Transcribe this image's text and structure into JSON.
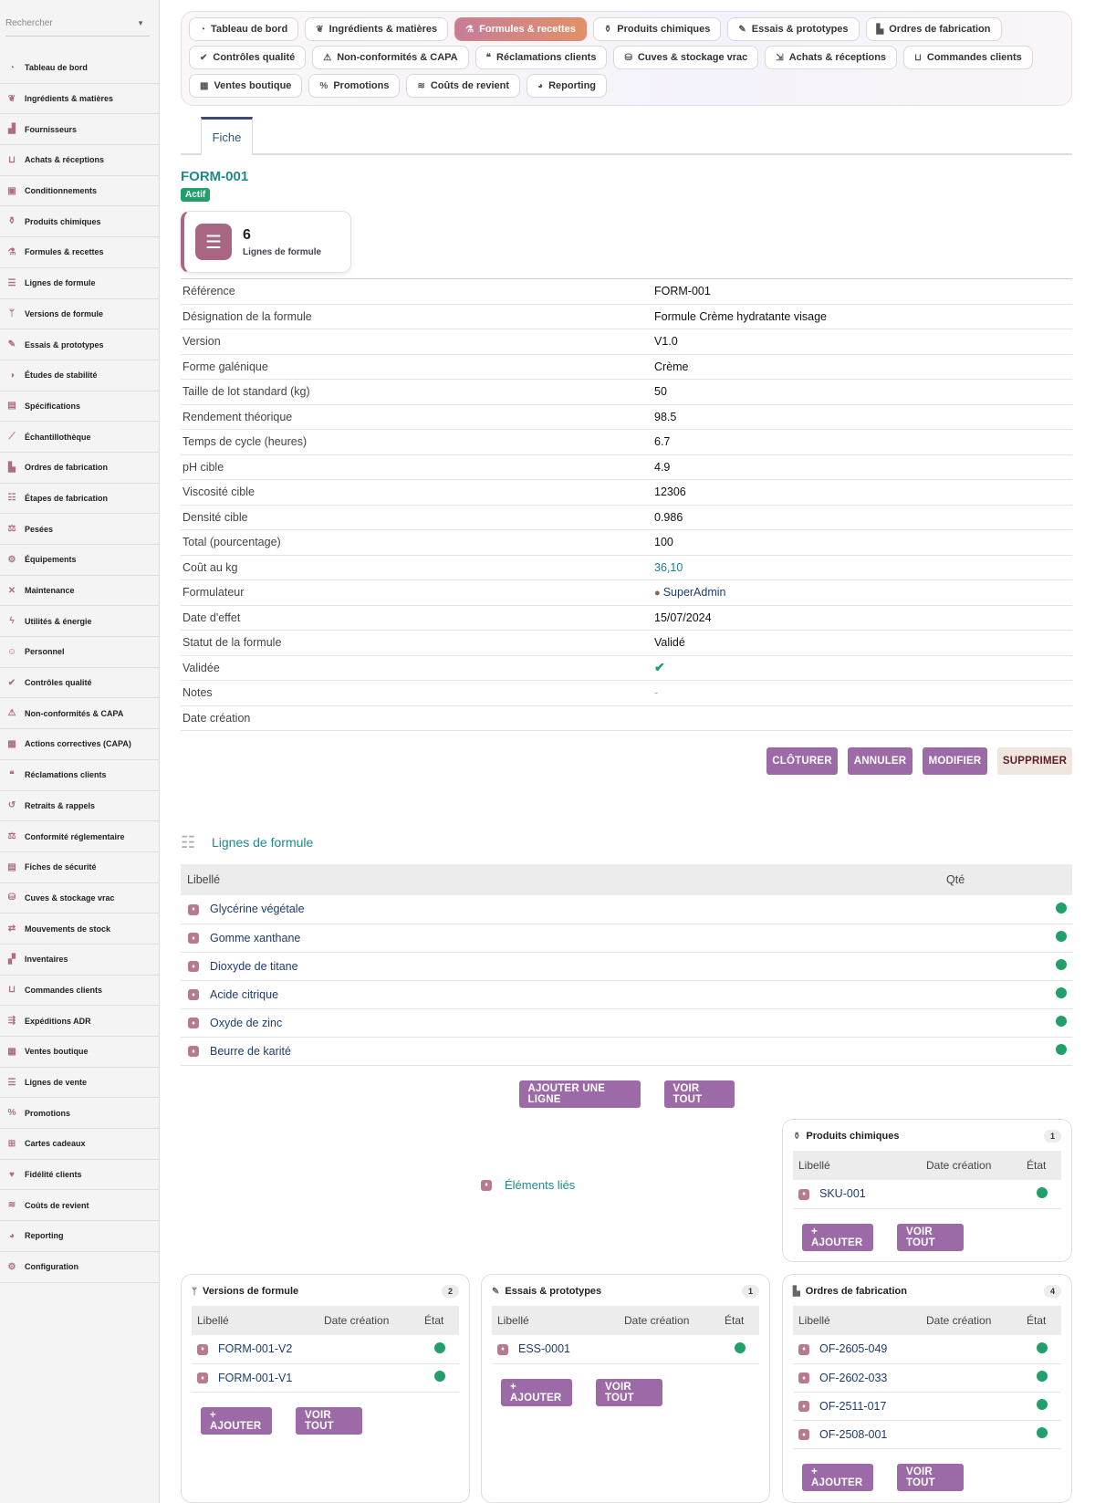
{
  "sidebar": {
    "search_placeholder": "Rechercher",
    "items": [
      {
        "label": "Tableau de bord",
        "icon": "dashboard-icon"
      },
      {
        "label": "Ingrédients & matières",
        "icon": "leaf-icon"
      },
      {
        "label": "Fournisseurs",
        "icon": "truck-icon"
      },
      {
        "label": "Achats & réceptions",
        "icon": "cart-icon"
      },
      {
        "label": "Conditionnements",
        "icon": "box-icon"
      },
      {
        "label": "Produits chimiques",
        "icon": "flask-icon"
      },
      {
        "label": "Formules & recettes",
        "icon": "beaker-icon"
      },
      {
        "label": "Lignes de formule",
        "icon": "list-icon"
      },
      {
        "label": "Versions de formule",
        "icon": "branch-icon"
      },
      {
        "label": "Essais & prototypes",
        "icon": "pen-icon"
      },
      {
        "label": "Études de stabilité",
        "icon": "gauge-icon"
      },
      {
        "label": "Spécifications",
        "icon": "file-icon"
      },
      {
        "label": "Échantillothèque",
        "icon": "pipette-icon"
      },
      {
        "label": "Ordres de fabrication",
        "icon": "factory-icon"
      },
      {
        "label": "Étapes de fabrication",
        "icon": "steps-icon"
      },
      {
        "label": "Pesées",
        "icon": "scale-icon"
      },
      {
        "label": "Équipements",
        "icon": "cogs-icon"
      },
      {
        "label": "Maintenance",
        "icon": "tools-icon"
      },
      {
        "label": "Utilités & énergie",
        "icon": "bolt-icon"
      },
      {
        "label": "Personnel",
        "icon": "users-icon"
      },
      {
        "label": "Contrôles qualité",
        "icon": "check-icon"
      },
      {
        "label": "Non-conformités & CAPA",
        "icon": "warning-icon"
      },
      {
        "label": "Actions correctives (CAPA)",
        "icon": "action-icon"
      },
      {
        "label": "Réclamations clients",
        "icon": "comment-icon"
      },
      {
        "label": "Retraits & rappels",
        "icon": "undo-icon"
      },
      {
        "label": "Conformité réglementaire",
        "icon": "balance-icon"
      },
      {
        "label": "Fiches de sécurité",
        "icon": "doc-icon"
      },
      {
        "label": "Cuves & stockage vrac",
        "icon": "tank-icon"
      },
      {
        "label": "Mouvements de stock",
        "icon": "exchange-icon"
      },
      {
        "label": "Inventaires",
        "icon": "boxes-icon"
      },
      {
        "label": "Commandes clients",
        "icon": "cart-icon"
      },
      {
        "label": "Expéditions ADR",
        "icon": "shipping-icon"
      },
      {
        "label": "Ventes boutique",
        "icon": "register-icon"
      },
      {
        "label": "Lignes de vente",
        "icon": "list-icon"
      },
      {
        "label": "Promotions",
        "icon": "percent-icon"
      },
      {
        "label": "Cartes cadeaux",
        "icon": "gift-icon"
      },
      {
        "label": "Fidélité clients",
        "icon": "heart-icon"
      },
      {
        "label": "Coûts de revient",
        "icon": "coins-icon"
      },
      {
        "label": "Reporting",
        "icon": "chart-icon"
      },
      {
        "label": "Configuration",
        "icon": "gear-icon"
      }
    ]
  },
  "topnav": [
    {
      "label": "Tableau de bord",
      "glyph": "◔",
      "active": false
    },
    {
      "label": "Ingrédients & matières",
      "glyph": "❦",
      "active": false
    },
    {
      "label": "Formules & recettes",
      "glyph": "⚗",
      "active": true
    },
    {
      "label": "Produits chimiques",
      "glyph": "⚱",
      "active": false
    },
    {
      "label": "Essais & prototypes",
      "glyph": "✎",
      "active": false
    },
    {
      "label": "Ordres de fabrication",
      "glyph": "▙",
      "active": false
    },
    {
      "label": "Contrôles qualité",
      "glyph": "✔",
      "active": false
    },
    {
      "label": "Non-conformités & CAPA",
      "glyph": "⚠",
      "active": false
    },
    {
      "label": "Réclamations clients",
      "glyph": "❝",
      "active": false
    },
    {
      "label": "Cuves & stockage vrac",
      "glyph": "⛁",
      "active": false
    },
    {
      "label": "Achats & réceptions",
      "glyph": "⇲",
      "active": false
    },
    {
      "label": "Commandes clients",
      "glyph": "⊔",
      "active": false
    },
    {
      "label": "Ventes boutique",
      "glyph": "▦",
      "active": false
    },
    {
      "label": "Promotions",
      "glyph": "%",
      "active": false
    },
    {
      "label": "Coûts de revient",
      "glyph": "≋",
      "active": false
    },
    {
      "label": "Reporting",
      "glyph": "◕",
      "active": false
    }
  ],
  "tab": {
    "label": "Fiche"
  },
  "record": {
    "title": "FORM-001",
    "status_badge": "Actif",
    "stat": {
      "value": "6",
      "label": "Lignes de formule"
    },
    "fields": [
      {
        "key": "Référence",
        "value": "FORM-001",
        "kind": "text"
      },
      {
        "key": "Désignation de la formule",
        "value": "Formule Crème hydratante visage",
        "kind": "text"
      },
      {
        "key": "Version",
        "value": "V1.0",
        "kind": "text"
      },
      {
        "key": "Forme galénique",
        "value": "Crème",
        "kind": "text"
      },
      {
        "key": "Taille de lot standard (kg)",
        "value": "50",
        "kind": "text"
      },
      {
        "key": "Rendement théorique",
        "value": "98.5",
        "kind": "text"
      },
      {
        "key": "Temps de cycle (heures)",
        "value": "6.7",
        "kind": "text"
      },
      {
        "key": "pH cible",
        "value": "4.9",
        "kind": "text"
      },
      {
        "key": "Viscosité cible",
        "value": "12306",
        "kind": "text"
      },
      {
        "key": "Densité cible",
        "value": "0.986",
        "kind": "text"
      },
      {
        "key": "Total (pourcentage)",
        "value": "100",
        "kind": "text"
      },
      {
        "key": "Coût au kg",
        "value": "36,10",
        "kind": "link"
      },
      {
        "key": "Formulateur",
        "value": "SuperAdmin",
        "kind": "user"
      },
      {
        "key": "Date d'effet",
        "value": "15/07/2024",
        "kind": "text"
      },
      {
        "key": "Statut de la formule",
        "value": "Validé",
        "kind": "text"
      },
      {
        "key": "Validée",
        "value": "✔",
        "kind": "check"
      },
      {
        "key": "Notes",
        "value": "-",
        "kind": "muted"
      },
      {
        "key": "Date création",
        "value": "",
        "kind": "text"
      }
    ],
    "actions": {
      "close": "CLÔTURER",
      "cancel": "ANNULER",
      "edit": "MODIFIER",
      "delete": "SUPPRIMER"
    }
  },
  "lines_section": {
    "title": "Lignes de formule",
    "headers": {
      "label": "Libellé",
      "qty": "Qté"
    },
    "rows": [
      "Glycérine végétale",
      "Gomme xanthane",
      "Dioxyde de titane",
      "Acide citrique",
      "Oxyde de zinc",
      "Beurre de karité"
    ],
    "add_label": "AJOUTER UNE LIGNE",
    "view_all": "VOIR TOUT"
  },
  "related": {
    "title": "Éléments liés"
  },
  "panels": {
    "chem": {
      "title": "Produits chimiques",
      "count": "1",
      "rows": [
        "SKU-001"
      ]
    },
    "versions": {
      "title": "Versions de formule",
      "count": "2",
      "rows": [
        "FORM-001-V2",
        "FORM-001-V1"
      ]
    },
    "trials": {
      "title": "Essais & prototypes",
      "count": "1",
      "rows": [
        "ESS-0001"
      ]
    },
    "orders": {
      "title": "Ordres de fabrication",
      "count": "4",
      "rows": [
        "OF-2605-049",
        "OF-2602-033",
        "OF-2511-017",
        "OF-2508-001"
      ]
    },
    "headers": {
      "label": "Libellé",
      "date": "Date création",
      "state": "État"
    },
    "add": "+ AJOUTER",
    "view_all": "VOIR TOUT"
  },
  "colors": {
    "accent": "#9c6aa6",
    "teal": "#1f8a8a",
    "ok": "#22a06b",
    "brand": "#a86683"
  }
}
